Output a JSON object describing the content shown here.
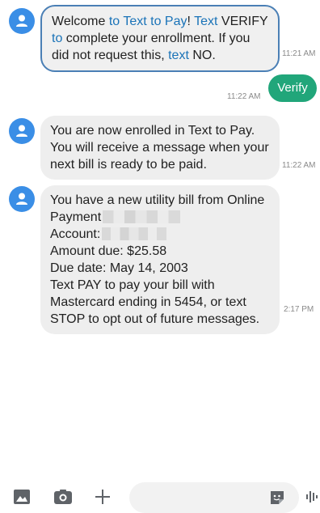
{
  "messages": [
    {
      "direction": "incoming",
      "segments": [
        "Welcome ",
        "to Text to Pay",
        "! ",
        "Text",
        " VERIFY ",
        "to",
        " complete your enrollment. If you did not request this, ",
        "text",
        " NO."
      ],
      "time": "11:21 AM"
    },
    {
      "direction": "outgoing",
      "text": "Verify",
      "time": "11:22 AM"
    },
    {
      "direction": "incoming",
      "text": "You are now enrolled in Text to Pay. You will receive a message when your next bill is ready to be paid.",
      "time": "11:22 AM"
    },
    {
      "direction": "incoming",
      "lines": {
        "l1": "You have a new utility bill from Online",
        "l2": "Payment",
        "l3": "Account:",
        "l4": "Amount due: $25.58",
        "l5": "Due date: May 14, 2003",
        "l6": "Text PAY to pay your bill with Mastercard ending in 5454, or text STOP to opt out of future messages."
      },
      "time": "2:17 PM"
    }
  ],
  "bottom_bar": {
    "icons": [
      "image-icon",
      "camera-icon",
      "plus-icon",
      "sticker-icon",
      "voice-icon"
    ]
  },
  "colors": {
    "accent_link": "#1a73b8",
    "outgoing_bubble": "#21a67a",
    "avatar": "#3a8ee6"
  }
}
